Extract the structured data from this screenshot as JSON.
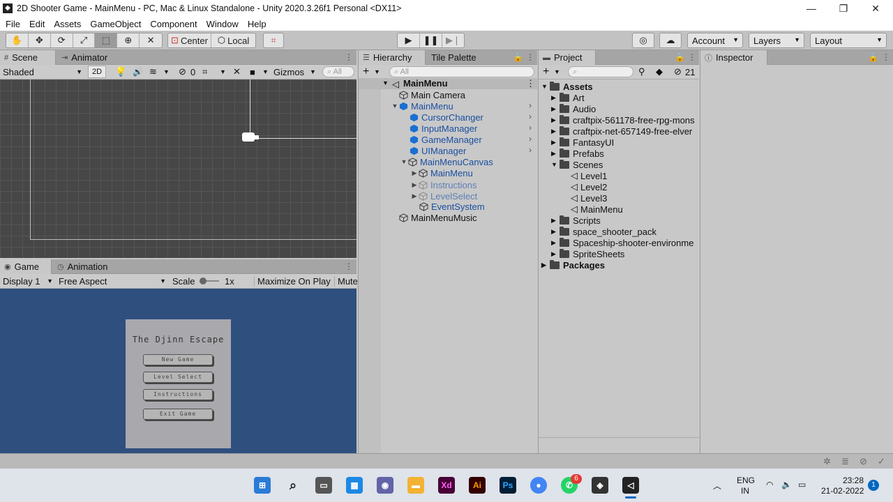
{
  "window": {
    "title": "2D Shooter Game - MainMenu - PC, Mac & Linux Standalone - Unity 2020.3.26f1 Personal <DX11>"
  },
  "menu": [
    "File",
    "Edit",
    "Assets",
    "GameObject",
    "Component",
    "Window",
    "Help"
  ],
  "toolbar": {
    "pivot": "Center",
    "space": "Local",
    "account": "Account",
    "layers": "Layers",
    "layout": "Layout"
  },
  "scene_panel": {
    "tabs": [
      "Scene",
      "Animator"
    ],
    "shading": "Shaded",
    "mode_2d": "2D",
    "hidden_count": "0",
    "gizmos": "Gizmos",
    "search_placeholder": "All"
  },
  "game_panel": {
    "tabs": [
      "Game",
      "Animation"
    ],
    "display": "Display 1",
    "aspect": "Free Aspect",
    "scale_label": "Scale",
    "scale_value": "1x",
    "maximize": "Maximize On Play",
    "mute": "Mute",
    "menu_title": "The Djinn Escape",
    "buttons": [
      "New Game",
      "Level Select",
      "Instructions",
      "Exit Game"
    ]
  },
  "hierarchy": {
    "tabs": [
      "Hierarchy",
      "Tile Palette"
    ],
    "search_placeholder": "All",
    "scene": "MainMenu",
    "items": [
      {
        "label": "Main Camera"
      },
      {
        "label": "MainMenu"
      },
      {
        "label": "CursorChanger"
      },
      {
        "label": "InputManager"
      },
      {
        "label": "GameManager"
      },
      {
        "label": "UIManager"
      },
      {
        "label": "MainMenuCanvas"
      },
      {
        "label": "MainMenu"
      },
      {
        "label": "Instructions"
      },
      {
        "label": "LevelSelect"
      },
      {
        "label": "EventSystem"
      },
      {
        "label": "MainMenuMusic"
      }
    ]
  },
  "project": {
    "tab": "Project",
    "hidden_count": "21",
    "root": "Assets",
    "folders": [
      "Art",
      "Audio",
      "craftpix-561178-free-rpg-mons",
      "craftpix-net-657149-free-elver",
      "FantasyUI",
      "Prefabs",
      "Scenes"
    ],
    "scenes": [
      "Level1",
      "Level2",
      "Level3",
      "MainMenu"
    ],
    "folders_after": [
      "Scripts",
      "space_shooter_pack",
      "Spaceship-shooter-environme",
      "SpriteSheets"
    ],
    "packages": "Packages"
  },
  "inspector": {
    "tab": "Inspector"
  },
  "taskbar": {
    "lang": "ENG",
    "region": "IN",
    "time": "23:28",
    "date": "21-02-2022",
    "whatsapp_badge": "6",
    "notif_count": "1"
  },
  "colors": {
    "game_bg": "#2f4f7f",
    "selected_blue": "#1a4fa0",
    "scene_bg": "#474747"
  }
}
